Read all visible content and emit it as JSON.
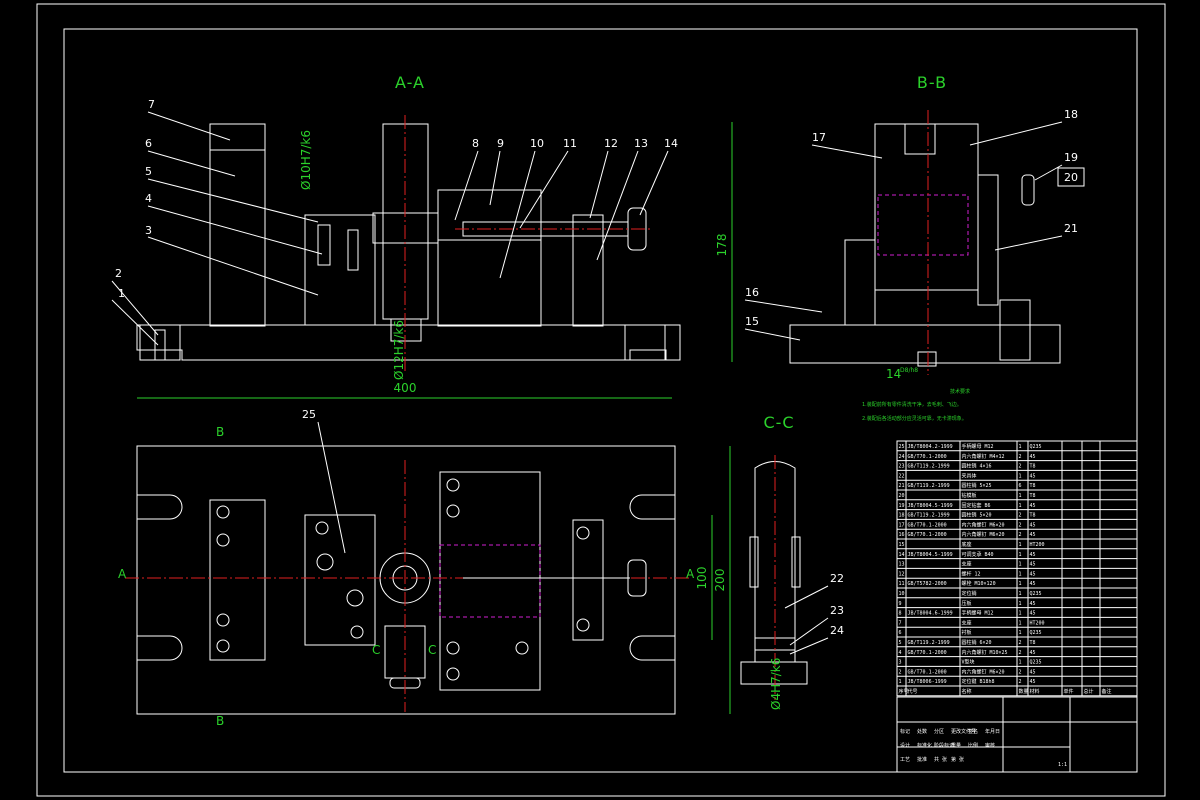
{
  "sections": {
    "aa": "A-A",
    "bb": "B-B",
    "cc": "C-C"
  },
  "dimensions": {
    "aa_width": "400",
    "bb_height": "178",
    "plan_height_inner": "100",
    "plan_height_outer": "200",
    "bb_keyway": "14",
    "bb_keyway_fit": "D8/h8"
  },
  "fits": {
    "phi10": "Ø10H7/k6",
    "phi12": "Ø12H7/k6",
    "phi4": "Ø4H7/k6"
  },
  "view_markers": {
    "a_left": "A",
    "a_right": "A",
    "b_top": "B",
    "b_bottom": "B",
    "c_left": "C",
    "c_right": "C"
  },
  "balloons": [
    "1",
    "2",
    "3",
    "4",
    "5",
    "6",
    "7",
    "8",
    "9",
    "10",
    "11",
    "12",
    "13",
    "14",
    "15",
    "16",
    "17",
    "18",
    "19",
    "20",
    "21",
    "22",
    "23",
    "24",
    "25"
  ],
  "notes_title": "技术要求",
  "notes_lines": [
    "1.装配前所有零件清洗干净，去毛刺、飞边。",
    "2.装配后各活动部分应灵活可靠，无卡滞现象。"
  ],
  "bom_rows": [
    [
      "25",
      "JB/T8004.2-1999",
      "手柄螺母 M12",
      "1",
      "Q235"
    ],
    [
      "24",
      "GB/T70.1-2000",
      "内六角螺钉 M4×12",
      "2",
      "45"
    ],
    [
      "23",
      "GB/T119.2-1999",
      "圆柱销 4×16",
      "2",
      "T8"
    ],
    [
      "22",
      "",
      "夹具体",
      "1",
      "45"
    ],
    [
      "21",
      "GB/T119.2-1999",
      "圆柱销 5×25",
      "6",
      "T8"
    ],
    [
      "20",
      "",
      "钻模板",
      "1",
      "T8"
    ],
    [
      "19",
      "JB/T8004.5-1999",
      "固定钻套 B6",
      "1",
      "45"
    ],
    [
      "18",
      "GB/T119.2-1999",
      "圆柱销 5×20",
      "2",
      "T8"
    ],
    [
      "17",
      "GB/T70.1-2000",
      "内六角螺钉 M6×20",
      "2",
      "45"
    ],
    [
      "16",
      "GB/T70.1-2000",
      "内六角螺钉 M6×20",
      "2",
      "45"
    ],
    [
      "15",
      "",
      "底座",
      "1",
      "HT200"
    ],
    [
      "14",
      "JB/T8004.5-1999",
      "可调支承 B40",
      "1",
      "45"
    ],
    [
      "13",
      "",
      "支座",
      "1",
      "45"
    ],
    [
      "12",
      "",
      "螺杆 12",
      "1",
      "45"
    ],
    [
      "11",
      "GB/T5782-2000",
      "螺栓 M10×120",
      "1",
      "45"
    ],
    [
      "10",
      "",
      "定位销",
      "1",
      "Q235"
    ],
    [
      "9",
      "",
      "压板",
      "1",
      "45"
    ],
    [
      "8",
      "JB/T8004.6-1999",
      "手柄螺母 M12",
      "1",
      "45"
    ],
    [
      "7",
      "",
      "支座",
      "1",
      "HT200"
    ],
    [
      "6",
      "",
      "衬板",
      "1",
      "Q235"
    ],
    [
      "5",
      "GB/T119.2-1999",
      "圆柱销 6×20",
      "2",
      "T8"
    ],
    [
      "4",
      "GB/T70.1-2000",
      "内六角螺钉 M10×25",
      "2",
      "45"
    ],
    [
      "3",
      "",
      "V型块",
      "1",
      "Q235"
    ],
    [
      "2",
      "GB/T70.1-2000",
      "内六角螺钉 M6×20",
      "2",
      "45"
    ],
    [
      "1",
      "JB/T8006-1999",
      "定位键 B18h8",
      "2",
      "45"
    ]
  ],
  "bom_header": [
    "序号",
    "代号",
    "名称",
    "数量",
    "材料",
    "单件",
    "总计",
    "备注"
  ],
  "title_block": {
    "labels": [
      "标记",
      "处数",
      "分区",
      "更改文件号",
      "签名",
      "年月日",
      "设计",
      "标准化",
      "阶段标记",
      "重量",
      "比例",
      "审核",
      "工艺",
      "批准",
      "共 张",
      "第 张"
    ],
    "scale": "1:1"
  },
  "colors": {
    "background": "#000000",
    "outline": "#ffffff",
    "dimension": "#2bd12b",
    "hatch": "#d8d838",
    "centerline": "#e02020",
    "hidden": "#d020d0"
  }
}
